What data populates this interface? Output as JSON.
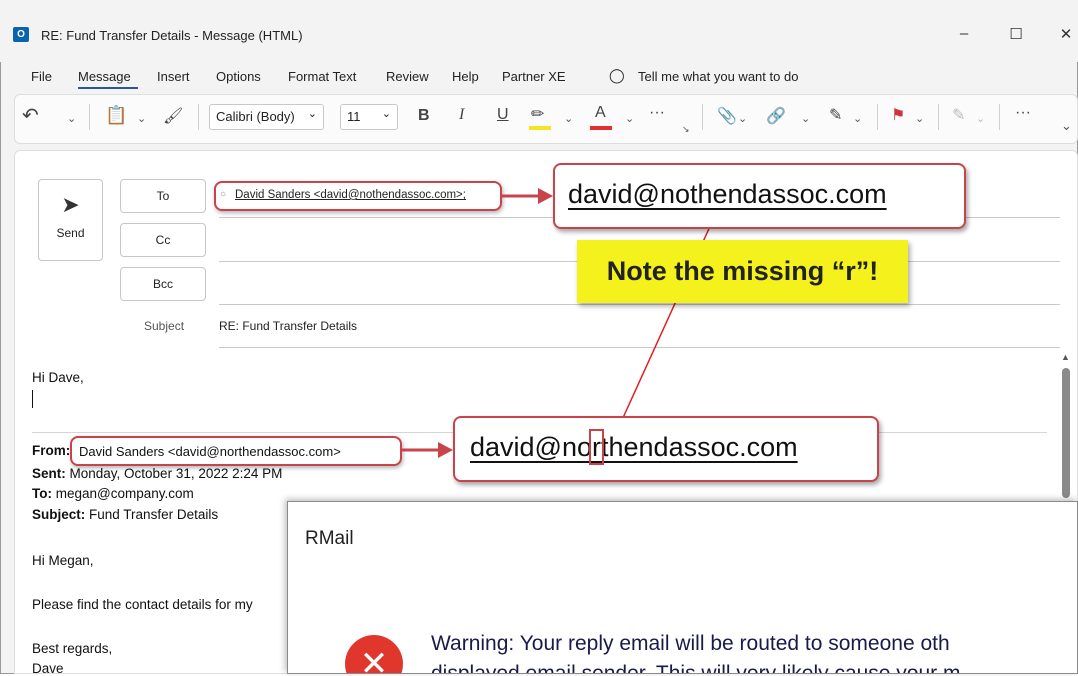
{
  "window": {
    "title": "RE: Fund Transfer Details  -  Message (HTML)",
    "app_icon": "outlook-icon",
    "minimize": "–",
    "maximize": "☐",
    "close": "✕"
  },
  "menu": {
    "items": [
      "File",
      "Message",
      "Insert",
      "Options",
      "Format Text",
      "Review",
      "Help",
      "Partner XE"
    ],
    "tell_me": "Tell me what you want to do"
  },
  "toolbar": {
    "font_name": "Calibri (Body)",
    "font_size": "11",
    "bold": "B",
    "italic": "I",
    "underline": "U",
    "more": "···",
    "colors": {
      "highlight": "#f5e51c",
      "font_color": "#e03030",
      "flag": "#d13438"
    }
  },
  "header": {
    "send_label": "Send",
    "to_label": "To",
    "cc_label": "Cc",
    "bcc_label": "Bcc",
    "subject_label": "Subject",
    "to_value": "David Sanders <david@nothendassoc.com>;",
    "subject_value": "RE: Fund Transfer Details"
  },
  "body": {
    "greeting": "Hi Dave,",
    "from_label": "From:",
    "from_value": "David Sanders <david@northendassoc.com>",
    "sent_label": "Sent:",
    "sent_value": "Monday, October 31, 2022 2:24 PM",
    "to_label": "To:",
    "to_value": "megan@company.com",
    "subject_label": "Subject:",
    "subject_value": "Fund Transfer Details",
    "hi": "Hi Megan,",
    "please": "Please find the contact details for my",
    "regards": "Best regards,",
    "sign": "Dave"
  },
  "callouts": {
    "reply_email": "david@nothendassoc.com",
    "original_pre": "david@no",
    "original_r": "r",
    "original_post": "thendassoc.com",
    "note": "Note the missing “r”!",
    "accent": "#c9434a"
  },
  "rmail": {
    "title": "RMail",
    "warning_line1": "Warning: Your reply email will be routed to someone oth",
    "warning_line2": "displayed email sender. This will very likely cause your m"
  }
}
